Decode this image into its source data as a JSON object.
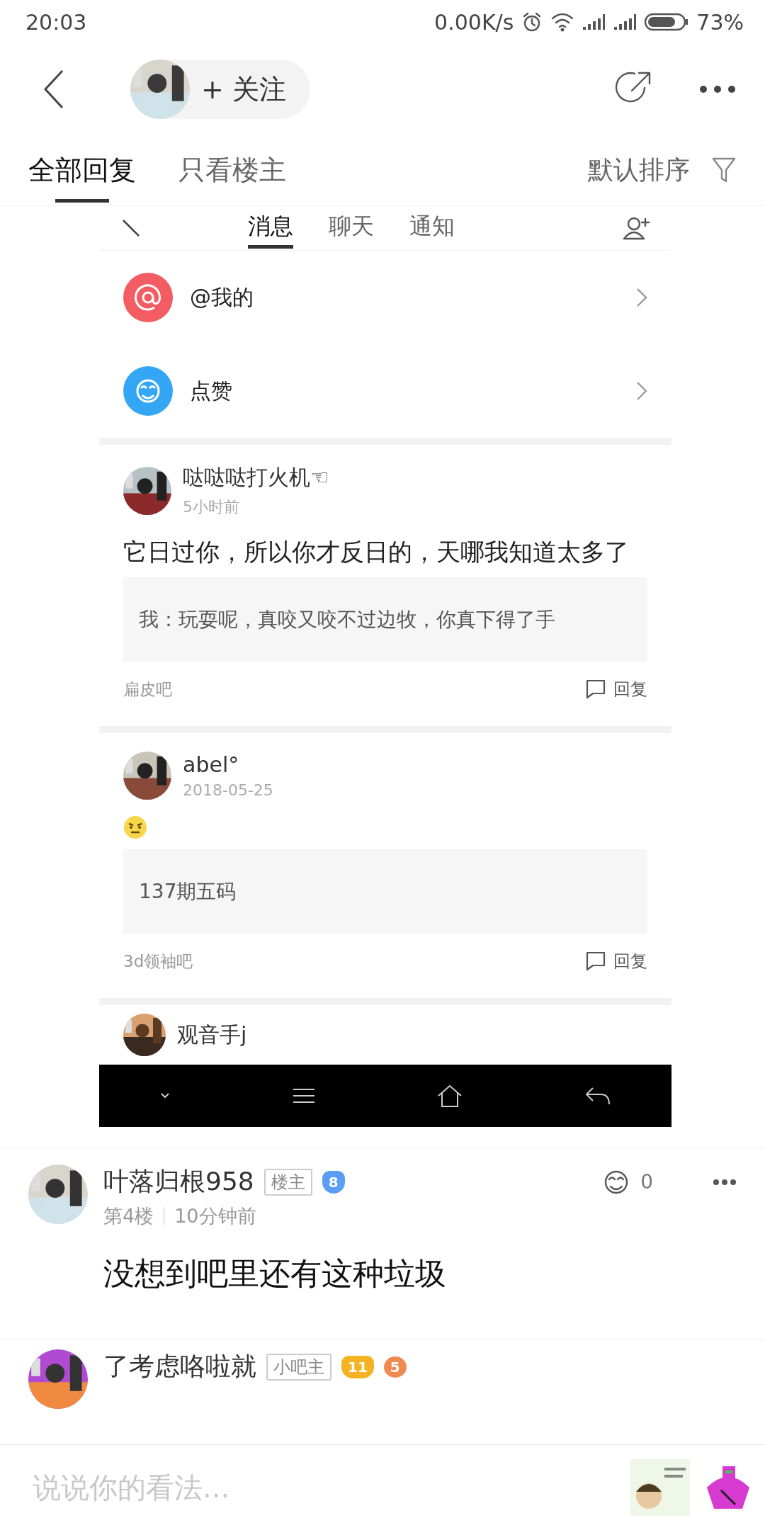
{
  "status_bar": {
    "time": "20:03",
    "net_speed": "0.00K/s",
    "battery": "73%"
  },
  "header": {
    "follow_button": "+ 关注"
  },
  "tabs": [
    {
      "label": "全部回复",
      "selected": true
    },
    {
      "label": "只看楼主",
      "selected": false
    }
  ],
  "sort": {
    "label": "默认排序"
  },
  "embedded_screenshot": {
    "tabs": [
      {
        "label": "消息",
        "selected": true
      },
      {
        "label": "聊天",
        "selected": false
      },
      {
        "label": "通知",
        "selected": false
      }
    ],
    "menu_items": [
      {
        "kind": "at",
        "label": "@我的",
        "color": "#f45c63"
      },
      {
        "kind": "like",
        "label": "点赞",
        "color": "#33a6f5"
      }
    ],
    "posts": [
      {
        "kind": "text",
        "author": "哒哒哒打火机☜",
        "time": "5小时前",
        "body": "它日过你，所以你才反日的，天哪我知道太多了",
        "quote": "我：玩耍呢，真咬又咬不过边牧，你真下得了手",
        "forum": "扁皮吧",
        "reply": "回复"
      },
      {
        "kind": "emoji",
        "author": "abel°",
        "time": "2018-05-25",
        "quote": "137期五码",
        "forum": "3d领袖吧",
        "reply": "回复"
      }
    ],
    "next_author": "观音手j"
  },
  "posts": [
    {
      "author": "叶落归根958",
      "badge": "楼主",
      "level": "8",
      "color": "#5b9cf5",
      "floor": "第4楼",
      "time": "10分钟前",
      "body": "没想到吧里还有这种垃圾",
      "likes": "0"
    },
    {
      "author": "了考虑咯啦就",
      "badge": "小吧主",
      "level": "11",
      "color": "#f5b323",
      "medal": "5"
    }
  ],
  "input": {
    "placeholder": "说说你的看法..."
  }
}
